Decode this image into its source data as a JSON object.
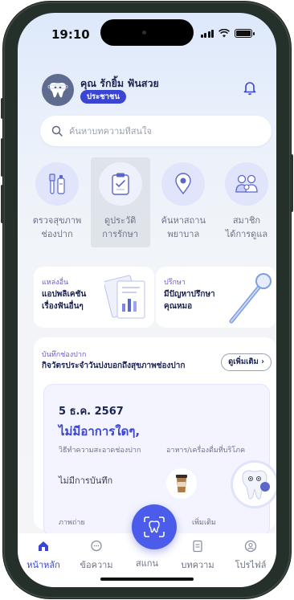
{
  "status_bar": {
    "time": "19:10"
  },
  "header": {
    "user_name": "คุณ รักยิ้ม ฟันสวย",
    "user_badge": "ประชาชน"
  },
  "search": {
    "placeholder": "ค้นหาบทความที่สนใจ"
  },
  "menu": [
    {
      "label": "ตรวจสุขภาพ\nช่องปาก",
      "icon": "toothbrush-icon"
    },
    {
      "label": "ดูประวัติ\nการรักษา",
      "icon": "clipboard-icon"
    },
    {
      "label": "ค้นหาสถาน\nพยาบาล",
      "icon": "location-pin-icon"
    },
    {
      "label": "สมาชิก\nได้การดูแล",
      "icon": "family-icon"
    }
  ],
  "promos": [
    {
      "tag": "แหล่งอื่น",
      "title": "แอปพลิเคชัน\nเรื่องฟันอื่นๆ"
    },
    {
      "tag": "ปรึกษา",
      "title": "มีปัญหาปรึกษา\nคุณหมอ"
    }
  ],
  "record": {
    "label": "บันทึกช่องปาก",
    "title": "กิจวัตรประจำวันบ่งบอกถึงสุขภาพช่องปาก",
    "see_more": "ดูเพิ่มเติม",
    "date": "5 ธ.ค. 2567",
    "symptom": "ไม่มีอาการใดๆ,",
    "col_clean": "วิธีทำความสะอาดช่องปาก",
    "col_food": "อาหาร/เครื่องดื่มที่บริโภค",
    "no_record": "ไม่มีการบันทึก",
    "photo": "ภาพถ่าย",
    "more": "เพิ่มเติม"
  },
  "bottom_nav": [
    {
      "label": "หน้าหลัก",
      "icon": "home-icon",
      "active": true
    },
    {
      "label": "ข้อความ",
      "icon": "message-icon",
      "active": false
    },
    {
      "label": "สแกน",
      "icon": "scan-tooth-icon",
      "active": false
    },
    {
      "label": "บทความ",
      "icon": "article-icon",
      "active": false
    },
    {
      "label": "โปรไฟล์",
      "icon": "profile-icon",
      "active": false
    }
  ],
  "colors": {
    "accent": "#3b45d4",
    "text_dark": "#1b2450",
    "tag_purple": "#6c57d8",
    "icon_bg": "#e1e5fb"
  }
}
